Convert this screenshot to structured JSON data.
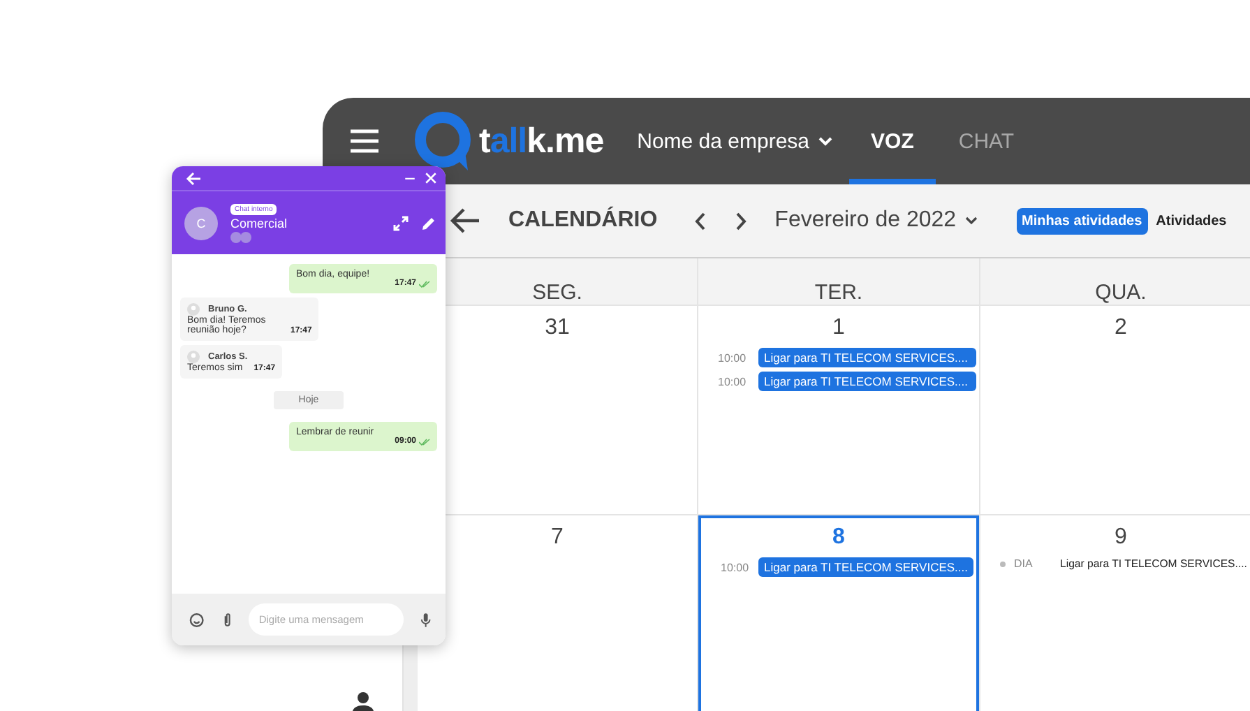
{
  "header": {
    "logo": [
      {
        "text": "t",
        "accent": false
      },
      {
        "text": "all",
        "accent": true
      },
      {
        "text": "k.me",
        "accent": false
      }
    ],
    "company": "Nome da empresa",
    "tabs": [
      {
        "label": "VOZ",
        "selected": true
      },
      {
        "label": "CHAT",
        "selected": false
      }
    ]
  },
  "toolbar": {
    "title": "CALENDÁRIO",
    "month": "Fevereiro de 2022",
    "filters": [
      {
        "label": "Minhas atividades",
        "selected": true
      },
      {
        "label": "Atividades",
        "selected": false
      }
    ]
  },
  "calendar": {
    "weekdays": [
      "SEG.",
      "TER.",
      "QUA."
    ],
    "weeks": [
      {
        "days": [
          {
            "day": "31",
            "selected": false
          },
          {
            "day": "1",
            "selected": false,
            "events": [
              {
                "kind": "timed",
                "time": "10:00",
                "title": "Ligar para TI TELECOM SERVICES...."
              },
              {
                "kind": "timed",
                "time": "10:00",
                "title": "Ligar para TI TELECOM SERVICES...."
              }
            ]
          },
          {
            "day": "2",
            "selected": false
          }
        ]
      },
      {
        "days": [
          {
            "day": "7",
            "selected": false
          },
          {
            "day": "8",
            "selected": true,
            "events": [
              {
                "kind": "timed",
                "time": "10:00",
                "title": "Ligar para TI TELECOM SERVICES...."
              }
            ]
          },
          {
            "day": "9",
            "selected": false,
            "events": [
              {
                "kind": "allday",
                "time": "DIA",
                "title": "Ligar para TI TELECOM SERVICES...."
              }
            ]
          }
        ]
      }
    ]
  },
  "chat": {
    "badge": "Chat interno",
    "name": "Comercial",
    "avatar": "C",
    "messages": [
      {
        "kind": "out",
        "text": "Bom dia, equipe!",
        "time": "17:47"
      },
      {
        "kind": "in",
        "author": "Bruno G.",
        "text": "Bom dia! Teremos reunião hoje?",
        "time": "17:47"
      },
      {
        "kind": "in",
        "author": "Carlos S.",
        "text": "Teremos sim",
        "time": "17:47"
      },
      {
        "kind": "divider",
        "text": "Hoje"
      },
      {
        "kind": "out",
        "text": "Lembrar de reunir",
        "time": "09:00"
      }
    ],
    "placeholder": "Digite uma mensagem"
  }
}
